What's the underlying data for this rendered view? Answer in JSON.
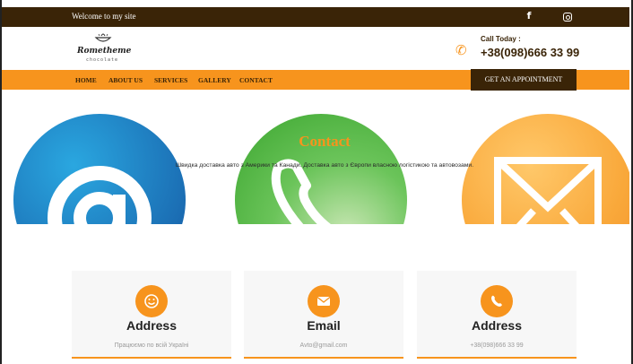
{
  "topbar": {
    "welcome": "Welcome to my site",
    "social": [
      {
        "icon": "facebook-icon",
        "glyph": "f"
      },
      {
        "icon": "instagram-icon"
      }
    ]
  },
  "header": {
    "logo": {
      "brand": "Romethemе",
      "sub": "chocolate"
    },
    "call_label": "Call Today :",
    "call_number": "+38(098)666 33 99"
  },
  "nav": {
    "items": [
      "HOME",
      "ABOUT US",
      "SERVICES",
      "GALLERY",
      "CONTACT"
    ],
    "appointment": "GET AN APPOINTMENT"
  },
  "hero": {
    "title": "Contact",
    "description": "Швидка доставка авто з Америки та Канади. Доставка авто з Європи власною логістикою та автовозами.",
    "circles": [
      "at-icon",
      "telephone-icon",
      "envelope-icon"
    ]
  },
  "cards": [
    {
      "icon": "smile-icon",
      "title": "Address",
      "text": "Працюємо по всій Україні"
    },
    {
      "icon": "mail-icon",
      "title": "Email",
      "text": "Avto@gmail.com"
    },
    {
      "icon": "phone-icon",
      "title": "Address",
      "text": "+38(098)666 33 99"
    }
  ],
  "colors": {
    "accent": "#f7941d",
    "dark": "#3a2407"
  }
}
